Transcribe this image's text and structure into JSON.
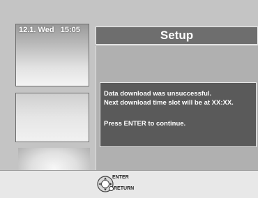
{
  "header": {
    "datetime": "12.1. Wed   15:05",
    "title": "Setup"
  },
  "message": {
    "line1": "Data download was unsuccessful.",
    "line2": "Next download time slot will be at XX:XX.",
    "line3": "Press ENTER to continue."
  },
  "controls": {
    "enter_label": "ENTER",
    "return_label": "RETURN",
    "icons": [
      "directional-pad-icon",
      "return-icon"
    ]
  }
}
